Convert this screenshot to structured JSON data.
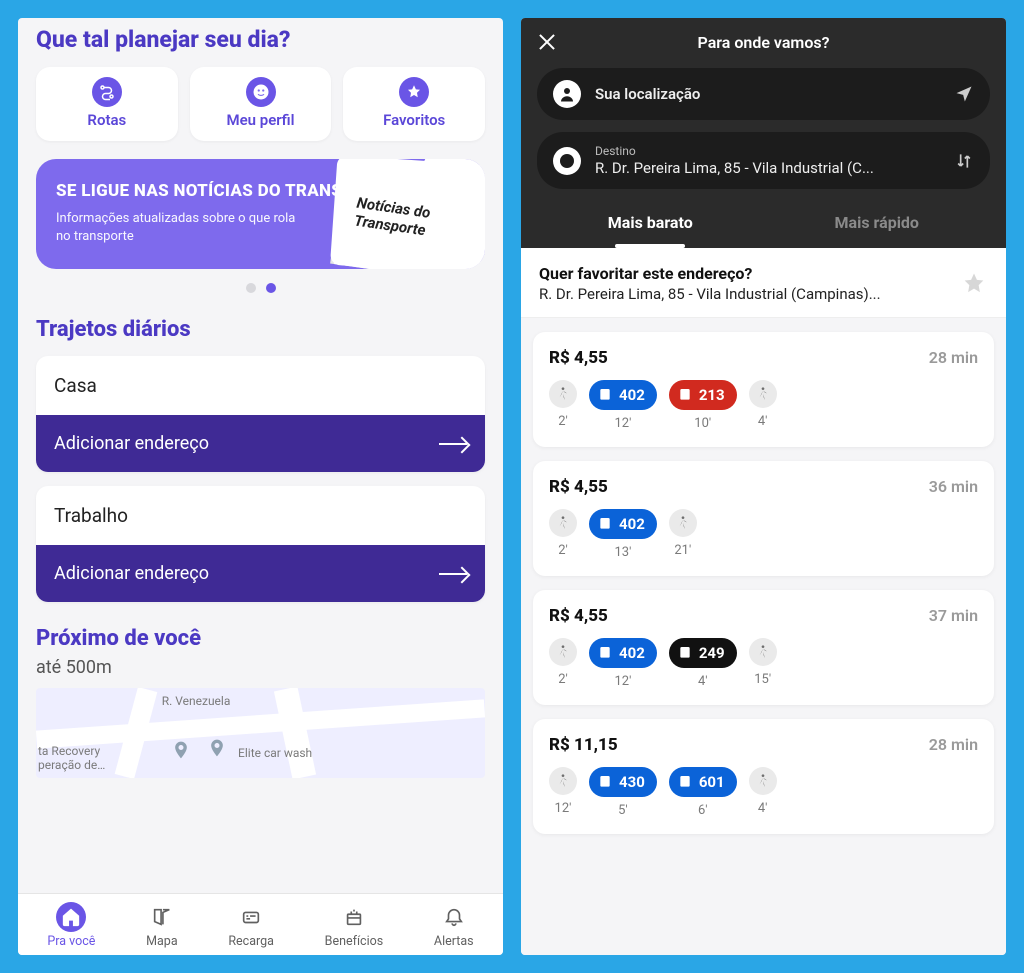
{
  "colors": {
    "accent": "#6a55e6",
    "deep": "#3f2a95",
    "blue": "#0b63d8",
    "red": "#d12a1f"
  },
  "left": {
    "heading": "Que tal planejar seu dia?",
    "chips": [
      {
        "label": "Rotas",
        "icon": "route-icon"
      },
      {
        "label": "Meu perfil",
        "icon": "profile-icon"
      },
      {
        "label": "Favoritos",
        "icon": "star-icon"
      }
    ],
    "banner": {
      "title": "SE LIGUE NAS NOTÍCIAS DO TRANSPORTE",
      "subtitle": "Informações atualizadas sobre o que rola no transporte",
      "newspaper": "Notícias do Transporte"
    },
    "trajetos_heading": "Trajetos diários",
    "trajetos": [
      {
        "label": "Casa",
        "action": "Adicionar endereço"
      },
      {
        "label": "Trabalho",
        "action": "Adicionar endereço"
      }
    ],
    "near_heading": "Próximo de você",
    "near_distance": "até 500m",
    "map_labels": [
      "R. Venezuela",
      "ta Recovery peração de…",
      "Elite car wash"
    ],
    "nav": [
      {
        "label": "Pra você",
        "active": true
      },
      {
        "label": "Mapa",
        "active": false
      },
      {
        "label": "Recarga",
        "active": false
      },
      {
        "label": "Benefícios",
        "active": false
      },
      {
        "label": "Alertas",
        "active": false
      }
    ]
  },
  "right": {
    "title": "Para onde vamos?",
    "origin_label": "Sua localização",
    "dest_label": "Destino",
    "dest_value": "R. Dr. Pereira Lima, 85 - Vila Industrial (C...",
    "tabs": [
      {
        "label": "Mais barato",
        "active": true
      },
      {
        "label": "Mais rápido",
        "active": false
      }
    ],
    "favorite_prompt": {
      "title": "Quer favoritar este endereço?",
      "address": "R. Dr. Pereira Lima, 85 - Vila Industrial (Campinas)..."
    },
    "routes": [
      {
        "price": "R$ 4,55",
        "duration": "28 min",
        "steps": [
          {
            "type": "walk",
            "time": "2'"
          },
          {
            "type": "bus",
            "line": "402",
            "color": "blue",
            "time": "12'"
          },
          {
            "type": "bus",
            "line": "213",
            "color": "red",
            "time": "10'"
          },
          {
            "type": "walk",
            "time": "4'"
          }
        ]
      },
      {
        "price": "R$ 4,55",
        "duration": "36 min",
        "steps": [
          {
            "type": "walk",
            "time": "2'"
          },
          {
            "type": "bus",
            "line": "402",
            "color": "blue",
            "time": "13'"
          },
          {
            "type": "walk",
            "time": "21'"
          }
        ]
      },
      {
        "price": "R$ 4,55",
        "duration": "37 min",
        "steps": [
          {
            "type": "walk",
            "time": "2'"
          },
          {
            "type": "bus",
            "line": "402",
            "color": "blue",
            "time": "12'"
          },
          {
            "type": "bus",
            "line": "249",
            "color": "black",
            "time": "4'"
          },
          {
            "type": "walk",
            "time": "15'"
          }
        ]
      },
      {
        "price": "R$ 11,15",
        "duration": "28 min",
        "steps": [
          {
            "type": "walk",
            "time": "12'"
          },
          {
            "type": "bus",
            "line": "430",
            "color": "blue",
            "time": "5'"
          },
          {
            "type": "bus",
            "line": "601",
            "color": "blue",
            "time": "6'"
          },
          {
            "type": "walk",
            "time": "4'"
          }
        ]
      }
    ]
  }
}
